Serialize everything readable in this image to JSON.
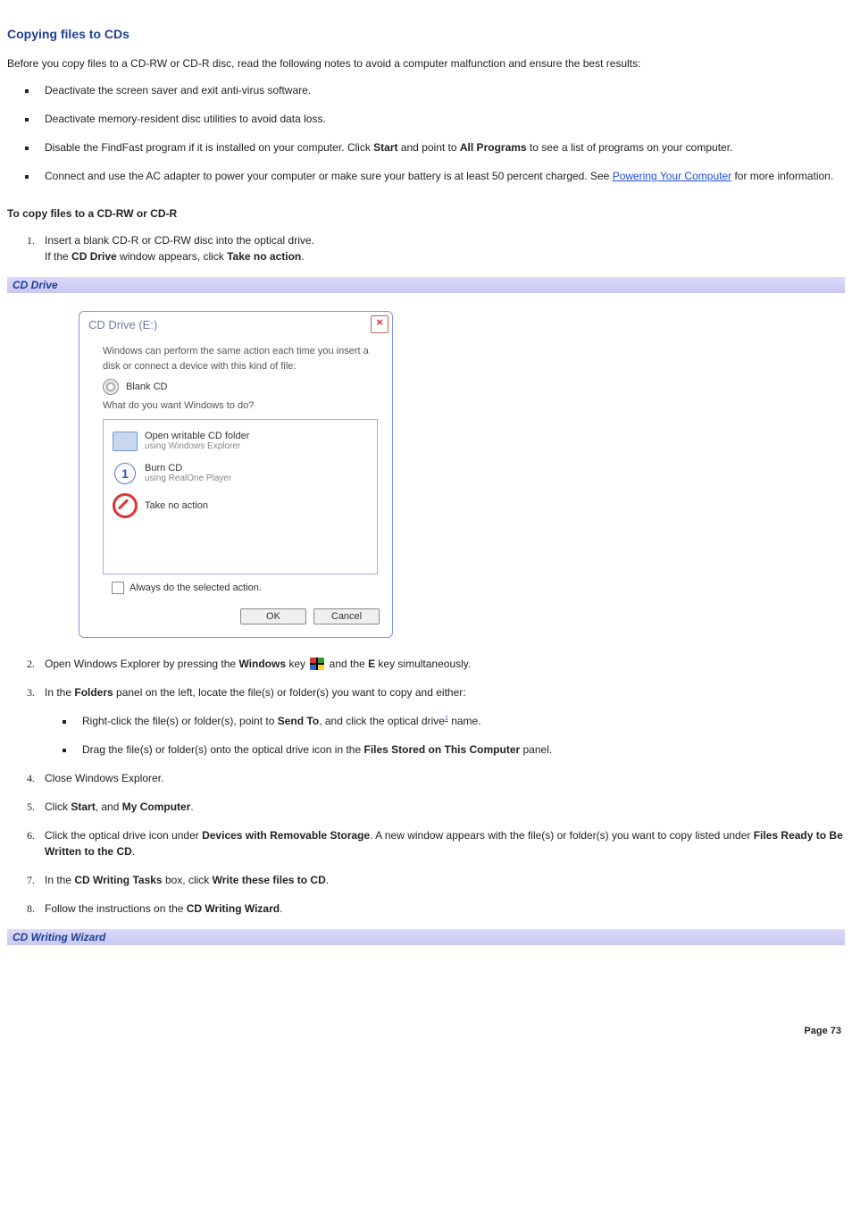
{
  "title": "Copying files to CDs",
  "intro": "Before you copy files to a CD-RW or CD-R disc, read the following notes to avoid a computer malfunction and ensure the best results:",
  "notes": {
    "n1": "Deactivate the screen saver and exit anti-virus software.",
    "n2": "Deactivate memory-resident disc utilities to avoid data loss.",
    "n3a": "Disable the FindFast program if it is installed on your computer. Click ",
    "n3_start": "Start",
    "n3b": " and point to ",
    "n3_all": "All Programs",
    "n3c": " to see a list of programs on your computer.",
    "n4a": "Connect and use the AC adapter to power your computer or make sure your battery is at least 50 percent charged. See ",
    "n4_link": "Powering Your Computer",
    "n4b": " for more information."
  },
  "subhead1": "To copy files to a CD-RW or CD-R",
  "step1": {
    "line1": "Insert a blank CD-R or CD-RW disc into the optical drive.",
    "line2a": "If the ",
    "line2_b1": "CD Drive",
    "line2b": " window appears, click ",
    "line2_b2": "Take no action",
    "line2c": "."
  },
  "caption1": "CD Drive",
  "dialog": {
    "title": "CD Drive (E:)",
    "msg": "Windows can perform the same action each time you insert a disk or connect a device with this kind of file:",
    "blank": "Blank CD",
    "prompt": "What do you want Windows to do?",
    "opt1a": "Open writable CD folder",
    "opt1b": "using Windows Explorer",
    "opt2a": "Burn CD",
    "opt2b": "using RealOne Player",
    "opt3": "Take no action",
    "check": "Always do the selected action.",
    "ok": "OK",
    "cancel": "Cancel"
  },
  "step2": {
    "a": "Open Windows Explorer by pressing the ",
    "b1": "Windows",
    "b": " key ",
    "c": " and the ",
    "b2": "E",
    "d": " key simultaneously."
  },
  "step3": {
    "a": "In the ",
    "b1": "Folders",
    "b": " panel on the left, locate the file(s) or folder(s) you want to copy and either:",
    "sub1a": "Right-click the file(s) or folder(s), point to ",
    "sub1_b": "Send To",
    "sub1b": ", and click the optical drive",
    "sub1_fn": "1",
    "sub1c": " name.",
    "sub2a": "Drag the file(s) or folder(s) onto the optical drive icon in the ",
    "sub2_b": "Files Stored on This Computer",
    "sub2b": " panel."
  },
  "step4": "Close Windows Explorer.",
  "step5": {
    "a": "Click ",
    "b1": "Start",
    "b": ", and ",
    "b2": "My Computer",
    "c": "."
  },
  "step6": {
    "a": "Click the optical drive icon under ",
    "b1": "Devices with Removable Storage",
    "b": ". A new window appears with the file(s) or folder(s) you want to copy listed under ",
    "b2": "Files Ready to Be Written to the CD",
    "c": "."
  },
  "step7": {
    "a": "In the ",
    "b1": "CD Writing Tasks",
    "b": " box, click ",
    "b2": "Write these files to CD",
    "c": "."
  },
  "step8": {
    "a": "Follow the instructions on the ",
    "b1": "CD Writing Wizard",
    "c": "."
  },
  "caption2": "CD Writing Wizard",
  "page": "Page 73"
}
